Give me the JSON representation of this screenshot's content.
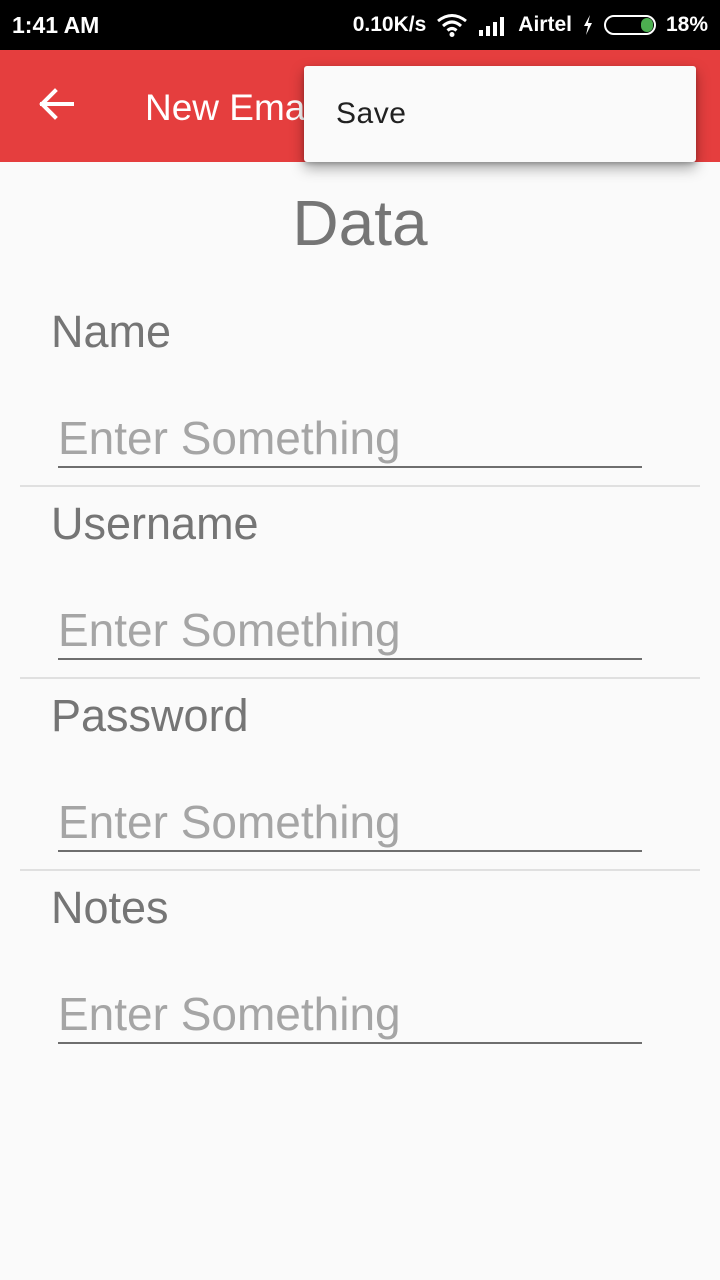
{
  "status_bar": {
    "time": "1:41 AM",
    "network_speed": "0.10K/s",
    "carrier": "Airtel",
    "battery_percent": "18%",
    "battery_level": 0.18,
    "icons": [
      "wifi-icon",
      "signal-icon",
      "charging-icon",
      "battery-icon"
    ]
  },
  "app_bar": {
    "title": "New Email",
    "back_icon": "arrow-left-icon",
    "color": "#e53e3e"
  },
  "menu": {
    "items": [
      {
        "label": "Save"
      }
    ]
  },
  "form": {
    "section_title": "Data",
    "fields": [
      {
        "label": "Name",
        "placeholder": "Enter Something",
        "value": ""
      },
      {
        "label": "Username",
        "placeholder": "Enter Something",
        "value": ""
      },
      {
        "label": "Password",
        "placeholder": "Enter Something",
        "value": ""
      },
      {
        "label": "Notes",
        "placeholder": "Enter Something",
        "value": ""
      }
    ]
  }
}
